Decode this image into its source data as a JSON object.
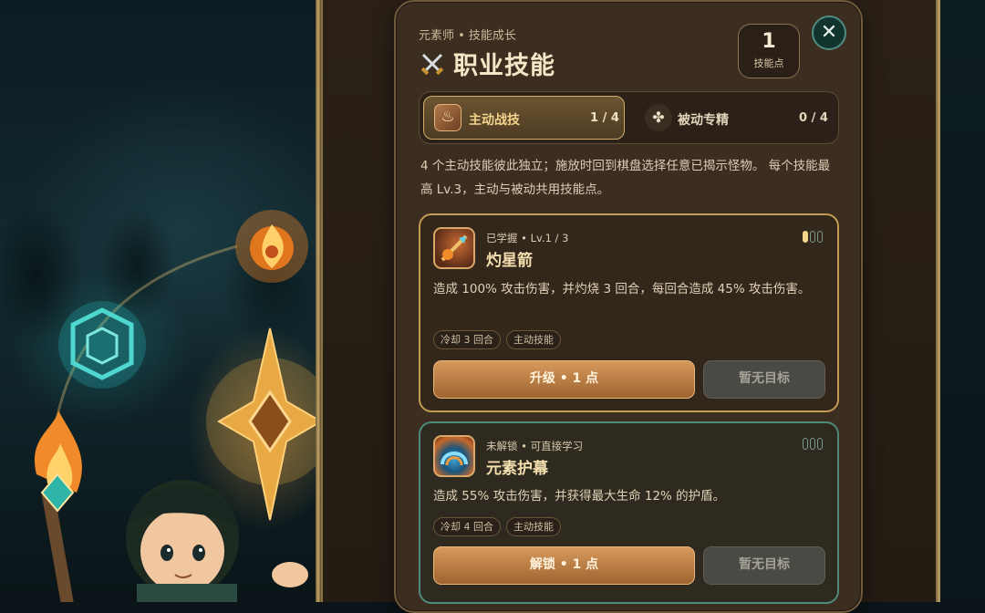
{
  "header": {
    "subtitle": "元素师 • 技能成长",
    "title": "职业技能",
    "points_value": "1",
    "points_label": "技能点",
    "close_glyph": "✕"
  },
  "tabs": [
    {
      "label": "主动战技",
      "count": "1 / 4",
      "icon": "torch-icon",
      "active": true
    },
    {
      "label": "被动专精",
      "count": "0 / 4",
      "icon": "clover-icon",
      "active": false
    }
  ],
  "description": "4 个主动技能彼此独立；施放时回到棋盘选择任意已揭示怪物。 每个技能最高 Lv.3，主动与被动共用技能点。",
  "skills": [
    {
      "status": "已学握 • Lv.1 / 3",
      "name": "灼星箭",
      "level": 1,
      "max_level": 3,
      "text": "造成 100% 攻击伤害，并灼烧 3 回合，每回合造成 45% 攻击伤害。",
      "tags": [
        "冷却 3 回合",
        "主动技能"
      ],
      "primary_label": "升级 • 1 点",
      "secondary_label": "暂无目标"
    },
    {
      "status": "未解锁 • 可直接学习",
      "name": "元素护幕",
      "level": 0,
      "max_level": 3,
      "text": "造成 55% 攻击伤害，并获得最大生命 12% 的护盾。",
      "tags": [
        "冷却 4 回合",
        "主动技能"
      ],
      "primary_label": "解锁 • 1 点",
      "secondary_label": "暂无目标"
    }
  ],
  "colors": {
    "accent_gold": "#c49b55",
    "accent_teal": "#4d8a78",
    "panel_bg": "#3b2d20"
  }
}
